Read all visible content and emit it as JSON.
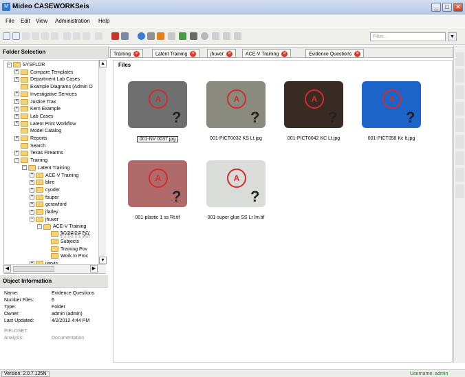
{
  "window": {
    "title": "Mideo CASEWORKSeis",
    "minimize": "_",
    "maximize": "□",
    "close": "✕"
  },
  "menu": [
    "File",
    "Edit",
    "View",
    "Administration",
    "Help"
  ],
  "toolbar": {
    "filter_placeholder": "Filter...",
    "filter_dropdown": "▼"
  },
  "folder_panel": {
    "title": "Folder Selection"
  },
  "tree": [
    {
      "label": "SYSFLDR",
      "depth": 0,
      "exp": "−"
    },
    {
      "label": "Compare Templates",
      "depth": 1,
      "exp": "+"
    },
    {
      "label": "Department Lab Cases",
      "depth": 1,
      "exp": "+"
    },
    {
      "label": "Example Diagrams (Admin O",
      "depth": 1,
      "exp": ""
    },
    {
      "label": "Investigative Services",
      "depth": 1,
      "exp": "+"
    },
    {
      "label": "Justice Trax",
      "depth": 1,
      "exp": "+"
    },
    {
      "label": "Kern Example",
      "depth": 1,
      "exp": "+"
    },
    {
      "label": "Lab Cases",
      "depth": 1,
      "exp": "+"
    },
    {
      "label": "Latent Print Workflow",
      "depth": 1,
      "exp": "+"
    },
    {
      "label": "Model Catalog",
      "depth": 1,
      "exp": ""
    },
    {
      "label": "Reports",
      "depth": 1,
      "exp": "+"
    },
    {
      "label": "Search",
      "depth": 1,
      "exp": ""
    },
    {
      "label": "Texas Firearms",
      "depth": 1,
      "exp": "+"
    },
    {
      "label": "Training",
      "depth": 1,
      "exp": "−"
    },
    {
      "label": "Latent Training",
      "depth": 2,
      "exp": "−"
    },
    {
      "label": "ACE-V Training",
      "depth": 3,
      "exp": "+"
    },
    {
      "label": "blire",
      "depth": 3,
      "exp": "+"
    },
    {
      "label": "cyoder",
      "depth": 3,
      "exp": "+"
    },
    {
      "label": "fsuper",
      "depth": 3,
      "exp": "+"
    },
    {
      "label": "gcrawford",
      "depth": 3,
      "exp": "+"
    },
    {
      "label": "jfarley",
      "depth": 3,
      "exp": "+"
    },
    {
      "label": "jhuver",
      "depth": 3,
      "exp": "−"
    },
    {
      "label": "ACE-V Training",
      "depth": 4,
      "exp": "−"
    },
    {
      "label": "Evidence Qu",
      "depth": 5,
      "exp": "",
      "selected": true
    },
    {
      "label": "Subjects",
      "depth": 5,
      "exp": ""
    },
    {
      "label": "Training Pov",
      "depth": 5,
      "exp": ""
    },
    {
      "label": "Work In Proc",
      "depth": 5,
      "exp": ""
    },
    {
      "label": "jjarvis",
      "depth": 3,
      "exp": "+"
    }
  ],
  "object_panel": {
    "title": "Object Information"
  },
  "object_info": [
    {
      "label": "Name:",
      "value": "Evidence Questions"
    },
    {
      "label": "Number Files:",
      "value": "6"
    },
    {
      "label": "Type:",
      "value": "Folder"
    },
    {
      "label": "Owner:",
      "value": "admin (admin)"
    },
    {
      "label": "Last Updated:",
      "value": "4/2/2012 4:44 PM"
    }
  ],
  "fieldset": {
    "label": "FIELDSET:",
    "analysis_label": "Analysis:",
    "analysis_value": "Documentation"
  },
  "tabs": [
    "Training",
    "Latent Training",
    "jhuver",
    "ACE-V Training",
    "Evidence Questions"
  ],
  "files_label": "Files",
  "files": [
    {
      "name": "001-NV 0037.jpg",
      "color": "#6f6f6f"
    },
    {
      "name": "001-PICT0032 KS Lt.jpg",
      "color": "#8a8a7e"
    },
    {
      "name": "001-PICT0042 KC Lt.jpg",
      "color": "#3a2a24"
    },
    {
      "name": "001-PICT058 Kc lt.jpg",
      "color": "#1d64c8"
    },
    {
      "name": "001-plastic 1 ss Rt.tif",
      "color": "#b06a6a"
    },
    {
      "name": "001-super glue SS Lr lm.tif",
      "color": "#d9dcd8"
    }
  ],
  "status": {
    "version": "Version: 2.0.7.125N",
    "username": "Username: admin"
  }
}
